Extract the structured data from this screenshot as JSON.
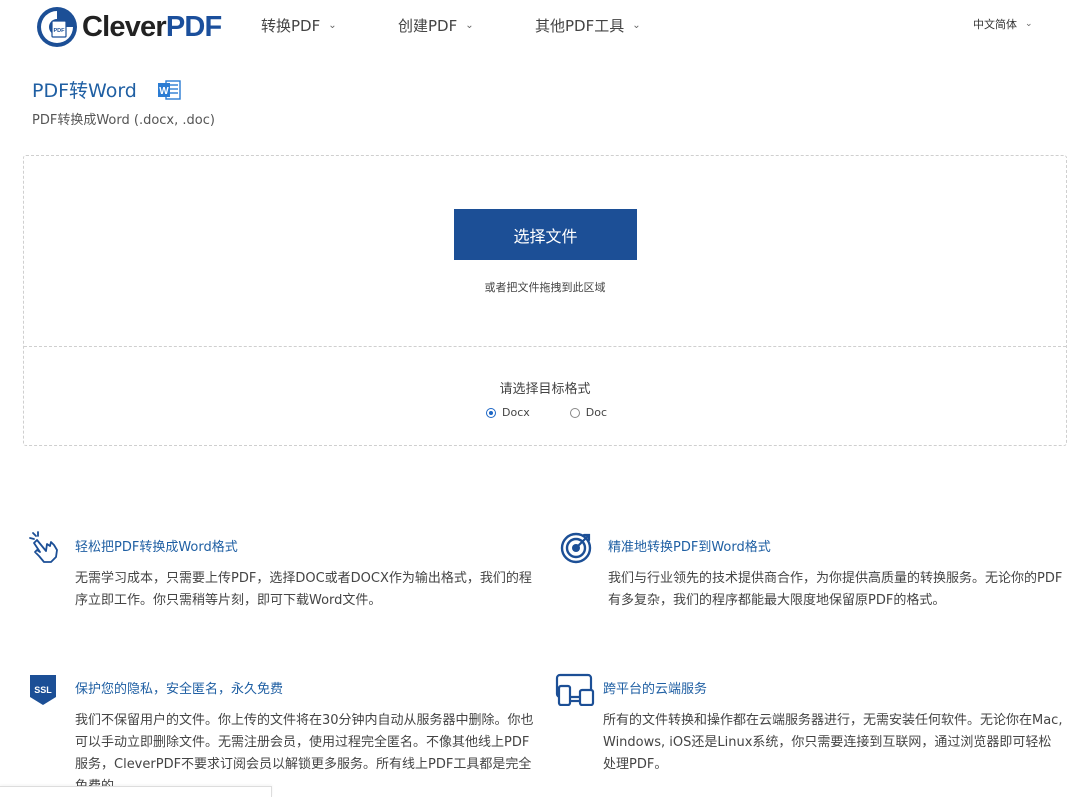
{
  "brand": {
    "name_prefix": "Clever",
    "name_suffix": "PDF",
    "mark_text": "PDF"
  },
  "nav": {
    "items": [
      {
        "label": "转换PDF"
      },
      {
        "label": "创建PDF"
      },
      {
        "label": "其他PDF工具"
      }
    ],
    "language": "中文简体"
  },
  "page": {
    "title": "PDF转Word",
    "word_icon_letter": "W",
    "subtitle": "PDF转换成Word (.docx, .doc)"
  },
  "upload": {
    "button_label": "选择文件",
    "drop_hint": "或者把文件拖拽到此区域",
    "format_label": "请选择目标格式",
    "formats": [
      {
        "label": "Docx",
        "selected": true
      },
      {
        "label": "Doc",
        "selected": false
      }
    ]
  },
  "features": [
    {
      "icon": "pointer-hand-icon",
      "title": "轻松把PDF转换成Word格式",
      "body": "无需学习成本，只需要上传PDF，选择DOC或者DOCX作为输出格式，我们的程序立即工作。你只需稍等片刻，即可下载Word文件。"
    },
    {
      "icon": "target-icon",
      "title": "精准地转换PDF到Word格式",
      "body": "我们与行业领先的技术提供商合作，为你提供高质量的转换服务。无论你的PDF有多复杂，我们的程序都能最大限度地保留原PDF的格式。"
    },
    {
      "icon": "ssl-shield-icon",
      "icon_text": "SSL",
      "title": "保护您的隐私，安全匿名，永久免费",
      "body": "我们不保留用户的文件。你上传的文件将在30分钟内自动从服务器中删除。你也可以手动立即删除文件。无需注册会员，使用过程完全匿名。不像其他线上PDF服务，CleverPDF不要求订阅会员以解锁更多服务。所有线上PDF工具都是完全免费的。"
    },
    {
      "icon": "devices-icon",
      "title": "跨平台的云端服务",
      "body": "所有的文件转换和操作都在云端服务器进行，无需安装任何软件。无论你在Mac, Windows, iOS还是Linux系统，你只需要连接到互联网，通过浏览器即可轻松处理PDF。"
    }
  ],
  "colors": {
    "brand_blue": "#1c4f96",
    "link_blue": "#1f5fa3",
    "word_blue": "#2b7cd3"
  }
}
